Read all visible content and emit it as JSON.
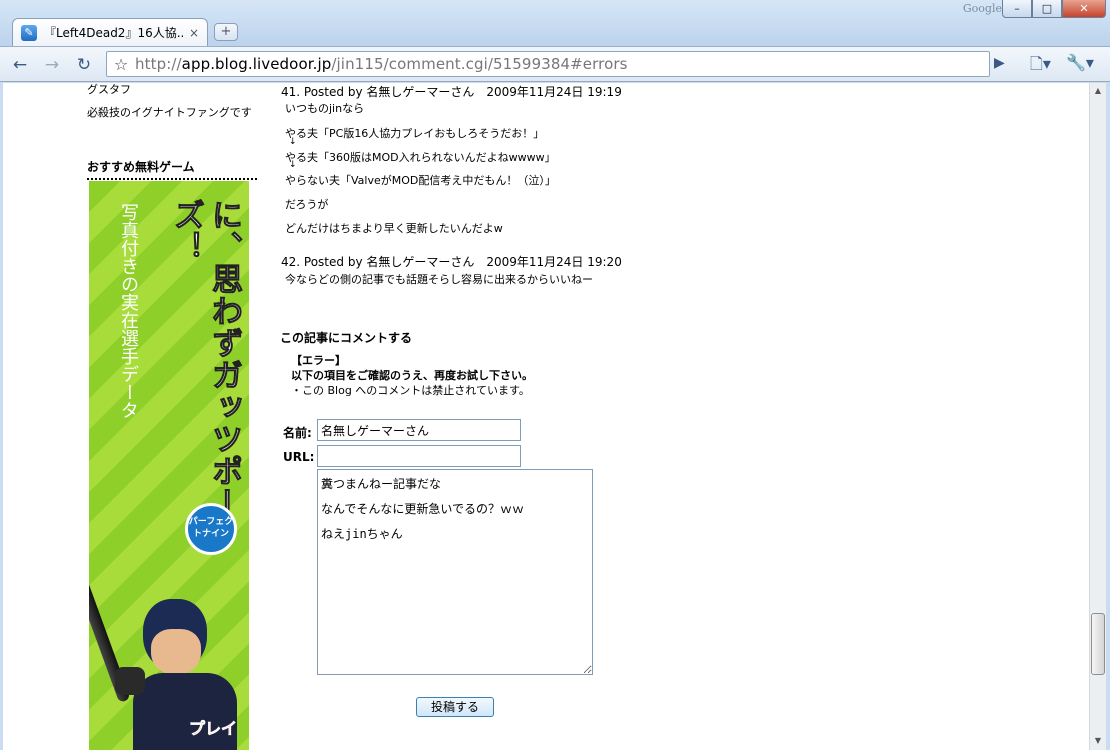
{
  "browser": {
    "brand": "Google",
    "tab_title": "『Left4Dead2』16人協...",
    "tab_close": "×",
    "new_tab": "+",
    "url_scheme": "http://",
    "url_host": "app.blog.livedoor.jp",
    "url_path": "/jin115/comment.cgi/51599384#errors",
    "window_buttons": {
      "minimize": "–",
      "maximize": "□",
      "close": "✕"
    }
  },
  "sidebar": {
    "line_1": "グスタフ",
    "line_2": "必殺技のイグナイトファングです",
    "heading": "おすすめ無料ゲーム",
    "banner": {
      "headline": "しょせんゲームなのに、思わずガッツポーズ！",
      "subtext": "写真付きの実在選手データ",
      "badge": "パーフェクトナイン",
      "cta": "プレイ"
    }
  },
  "comments": [
    {
      "header": "41. Posted by 名無しゲーマーさん　2009年11月24日 19:19",
      "lines": [
        "いつものjinなら",
        "やる夫「PC版16人協力プレイおもしろそうだお！」",
        "↓",
        "やる夫「360版はMOD入れられないんだよねwwww」",
        "↓",
        "やらない夫「ValveがMOD配信考え中だもん！（泣）」",
        "だろうが",
        "どんだけはちまより早く更新したいんだよw"
      ]
    },
    {
      "header": "42. Posted by 名無しゲーマーさん　2009年11月24日 19:20",
      "lines": [
        "今ならどの側の記事でも話題そらし容易に出来るからいいねー"
      ]
    }
  ],
  "form": {
    "title": "この記事にコメントする",
    "error_heading": "【エラー】",
    "error_message": "以下の項目をご確認のうえ、再度お試し下さい。",
    "error_detail": "・この Blog へのコメントは禁止されています。",
    "name_label": "名前:",
    "name_value": "名無しゲーマーさん",
    "url_label": "URL:",
    "url_value": "",
    "comment_value": "糞つまんねー記事だな\nなんでそんなに更新急いでるの？ｗｗ\nねえjinちゃん",
    "submit_label": "投稿する"
  }
}
